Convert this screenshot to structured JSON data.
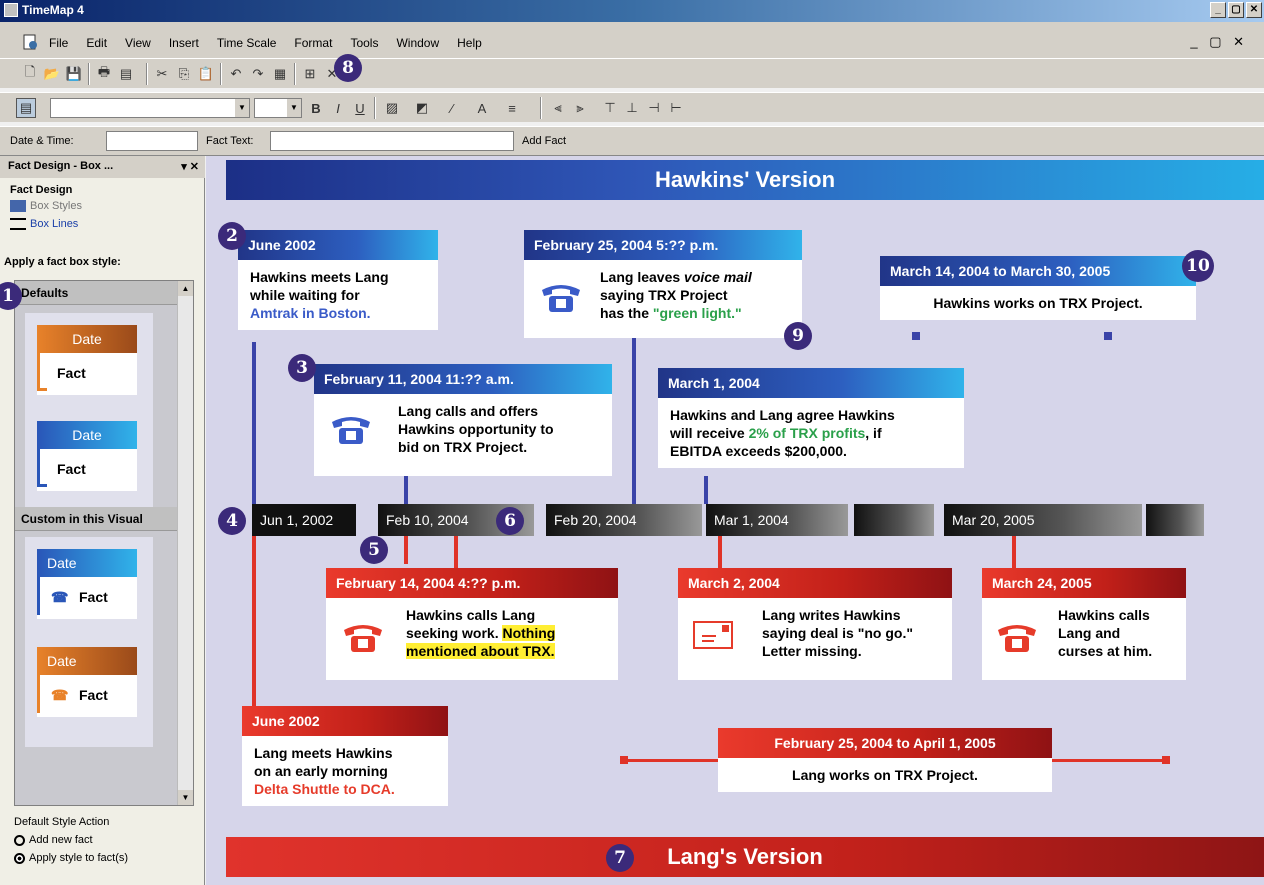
{
  "window": {
    "title": "TimeMap 4",
    "controls": [
      "_",
      "▢",
      "✕"
    ]
  },
  "menu": [
    "File",
    "Edit",
    "View",
    "Insert",
    "Time Scale",
    "Format",
    "Tools",
    "Window",
    "Help"
  ],
  "mdi_controls": "_ ▢ ✕",
  "factbar": {
    "date_label": "Date & Time:",
    "fact_label": "Fact Text:",
    "add_button": "Add Fact"
  },
  "pane": {
    "header": "Fact Design - Box ...",
    "section": "Fact Design",
    "links": [
      "Box Styles",
      "Box Lines"
    ],
    "apply_title": "Apply a fact box style:",
    "group_defaults": "Defaults",
    "group_custom": "Custom in this Visual",
    "card_date": "Date",
    "card_fact": "Fact",
    "action_title": "Default Style Action",
    "opt_new": "Add new fact",
    "opt_apply": "Apply style to fact(s)"
  },
  "canvas": {
    "top_title": "Hawkins' Version",
    "bottom_title": "Lang's Version",
    "timeline": [
      "Jun 1, 2002",
      "Feb 10, 2004",
      "Feb 20, 2004",
      "Mar 1, 2004",
      "Mar 20, 2005"
    ],
    "facts": {
      "b1": {
        "date": "June 2002",
        "t1": "Hawkins meets Lang",
        "t2": "while waiting for",
        "t3": "Amtrak in Boston."
      },
      "b2": {
        "date": "February 11, 2004 11:?? a.m.",
        "t1": "Lang calls and offers",
        "t2": "Hawkins opportunity to",
        "t3": "bid on TRX Project."
      },
      "b3": {
        "date": "February 25, 2004 5:?? p.m.",
        "t1a": "Lang leaves ",
        "t1b": "voice mail",
        "t2": "saying TRX Project",
        "t3a": "has the ",
        "t3b": "\"green light.\""
      },
      "b4": {
        "date": "March 1, 2004",
        "t1": "Hawkins and Lang agree Hawkins",
        "t2a": "will receive ",
        "t2b": "2% of TRX profits",
        "t2c": ", if",
        "t3": "EBITDA exceeds $200,000."
      },
      "b5": {
        "date": "March 14, 2004 to March 30, 2005",
        "t1": "Hawkins works on TRX Project."
      },
      "r1": {
        "date": "February 14, 2004 4:?? p.m.",
        "t1": "Hawkins calls Lang",
        "t2a": "seeking work. ",
        "t2b": "Nothing",
        "t3": "mentioned about TRX."
      },
      "r2": {
        "date": "March 2, 2004",
        "t1": "Lang writes Hawkins",
        "t2": "saying deal is \"no go.\"",
        "t3": "Letter missing."
      },
      "r3": {
        "date": "March 24, 2005",
        "t1": "Hawkins calls",
        "t2": "Lang and",
        "t3": "curses at him."
      },
      "r4": {
        "date": "June 2002",
        "t1": "Lang meets Hawkins",
        "t2": "on an early morning",
        "t3": "Delta Shuttle to DCA."
      },
      "r5": {
        "date": "February 25, 2004 to April 1, 2005",
        "t1": "Lang works on TRX Project."
      }
    },
    "badges": [
      "1",
      "2",
      "3",
      "4",
      "5",
      "6",
      "7",
      "8",
      "9",
      "10"
    ]
  },
  "colors": {
    "blue": "#2d5fc0",
    "red": "#c22019",
    "canvas": "#d6d5ea"
  }
}
